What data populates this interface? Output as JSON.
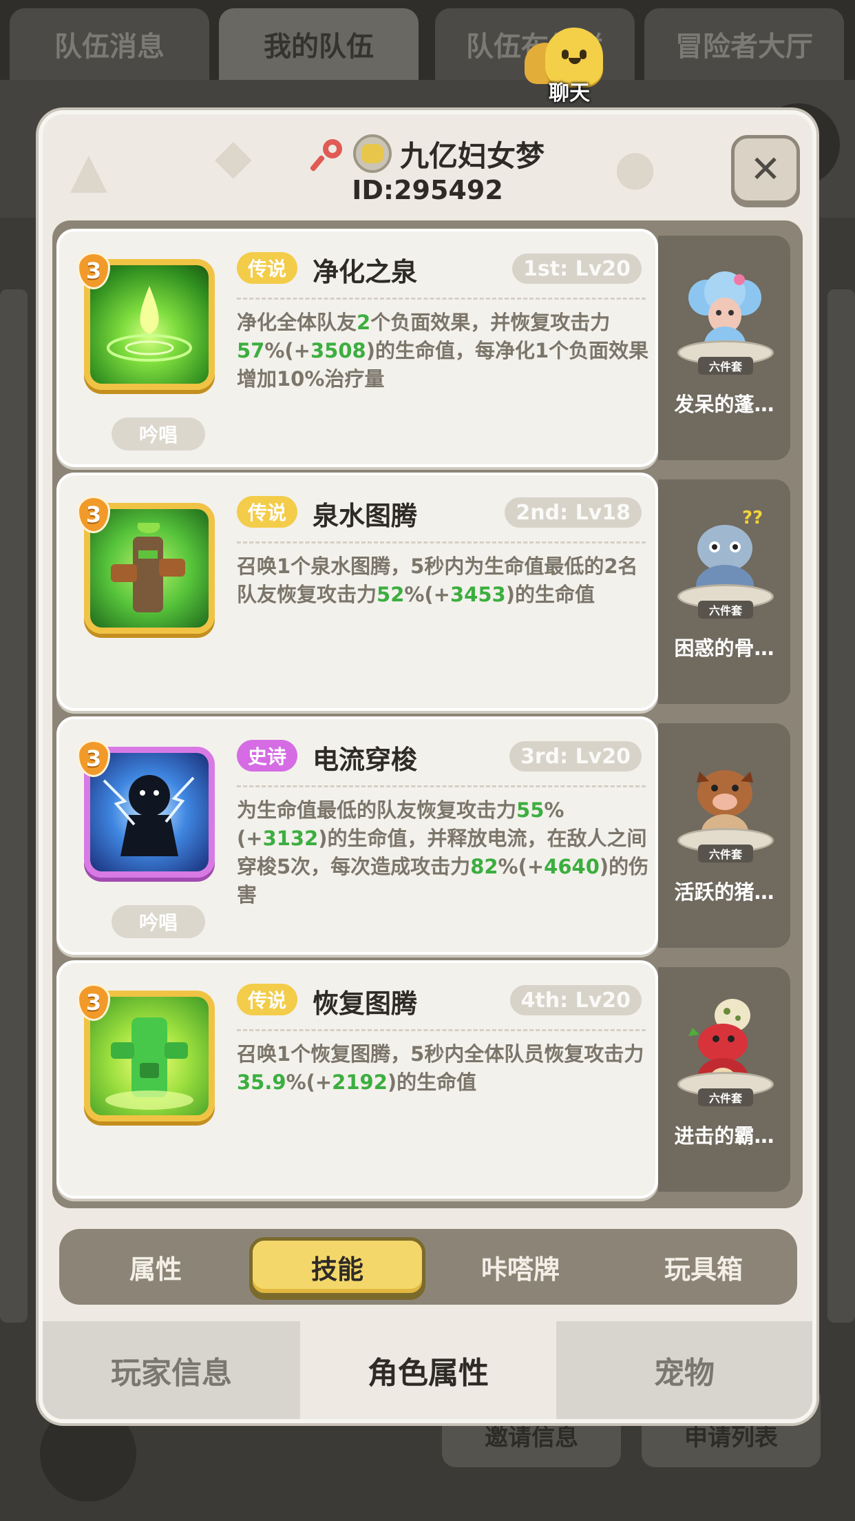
{
  "bg_tabs": [
    "队伍消息",
    "我的队伍",
    "队伍布告栏",
    "冒险者大厅"
  ],
  "chat": {
    "label": "聊天"
  },
  "bg_bottom_buttons": [
    "邀请信息",
    "申请列表"
  ],
  "player": {
    "name": "九亿妇女梦",
    "id": "ID:295492"
  },
  "skills": [
    {
      "rank": "3",
      "rarity": "传说",
      "rarity_type": "legend",
      "name": "净化之泉",
      "level": "1st: Lv20",
      "desc": [
        "净化全体队友",
        "2",
        "个负面效果，并恢复攻击力",
        "57",
        "%(+",
        "3508",
        ")的生命值，每净化1个负面效果增加10%治疗量"
      ],
      "chant": "吟唱",
      "pet_name": "发呆的蓬…",
      "pet_set": "六件套",
      "icon_color": "#4fc23b"
    },
    {
      "rank": "3",
      "rarity": "传说",
      "rarity_type": "legend",
      "name": "泉水图腾",
      "level": "2nd: Lv18",
      "desc": [
        "召唤1个泉水图腾，5秒内为生命值最低的2名队友恢复攻击力",
        "52",
        "%(+",
        "3453",
        ")的生命值"
      ],
      "chant": "",
      "pet_name": "困惑的骨…",
      "pet_set": "六件套",
      "icon_color": "#3fb33c"
    },
    {
      "rank": "3",
      "rarity": "史诗",
      "rarity_type": "epic",
      "name": "电流穿梭",
      "level": "3rd: Lv20",
      "desc": [
        "为生命值最低的队友恢复攻击力",
        "55",
        "%(+",
        "3132",
        ")的生命值，并释放电流，在敌人之间穿梭5次，每次造成攻击力",
        "82",
        "%(+",
        "4640",
        ")的伤害"
      ],
      "chant": "吟唱",
      "pet_name": "活跃的猪…",
      "pet_set": "六件套",
      "icon_color": "#2d6fd6"
    },
    {
      "rank": "3",
      "rarity": "传说",
      "rarity_type": "legend",
      "name": "恢复图腾",
      "level": "4th: Lv20",
      "desc": [
        "召唤1个恢复图腾，5秒内全体队员恢复攻击力",
        "35.9",
        "%(+",
        "2192",
        ")的生命值"
      ],
      "chant": "",
      "pet_name": "进击的霸…",
      "pet_set": "六件套",
      "icon_color": "#55cf44"
    }
  ],
  "subtabs": [
    "属性",
    "技能",
    "咔嗒牌",
    "玩具箱"
  ],
  "bottomtabs": [
    "玩家信息",
    "角色属性",
    "宠物"
  ],
  "colors": {
    "legend": "#f3cc49",
    "epic": "#d56ce4",
    "green_value": "#3cae3f",
    "active_subtab": "#f4d76a"
  }
}
